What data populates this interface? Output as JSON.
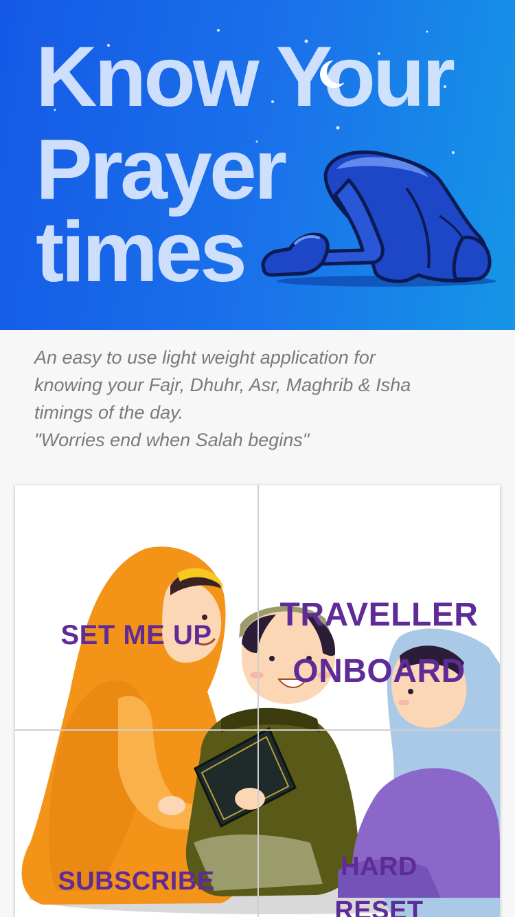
{
  "banner": {
    "title_line1": "Know Your",
    "title_line2": "Prayer",
    "title_line3": "times",
    "decorations": [
      "moon-icon",
      "star-icons",
      "praying-figure-icon"
    ],
    "colors": {
      "gradient_start": "#1559e6",
      "gradient_end": "#1596e6",
      "title_text": "#dde8ff",
      "figure_fill": "#1e47c8"
    }
  },
  "description": {
    "line1": "An easy to use light weight application for",
    "line2": "knowing your Fajr, Dhuhr, Asr, Maghrib & Isha",
    "line3": "timings of the day.",
    "quote": "\"Worries end when Salah begins\""
  },
  "tiles": {
    "set_me_up": "SET ME UP",
    "traveller_line1": "TRAVELLER",
    "traveller_line2": "ONBOARD",
    "subscribe": "SUBSCRIBE",
    "hard_reset_line1": "HARD",
    "hard_reset_line2": "RESET",
    "label_color": "#5e2b97"
  },
  "illustration": {
    "icon": "family-reading-illustration"
  }
}
